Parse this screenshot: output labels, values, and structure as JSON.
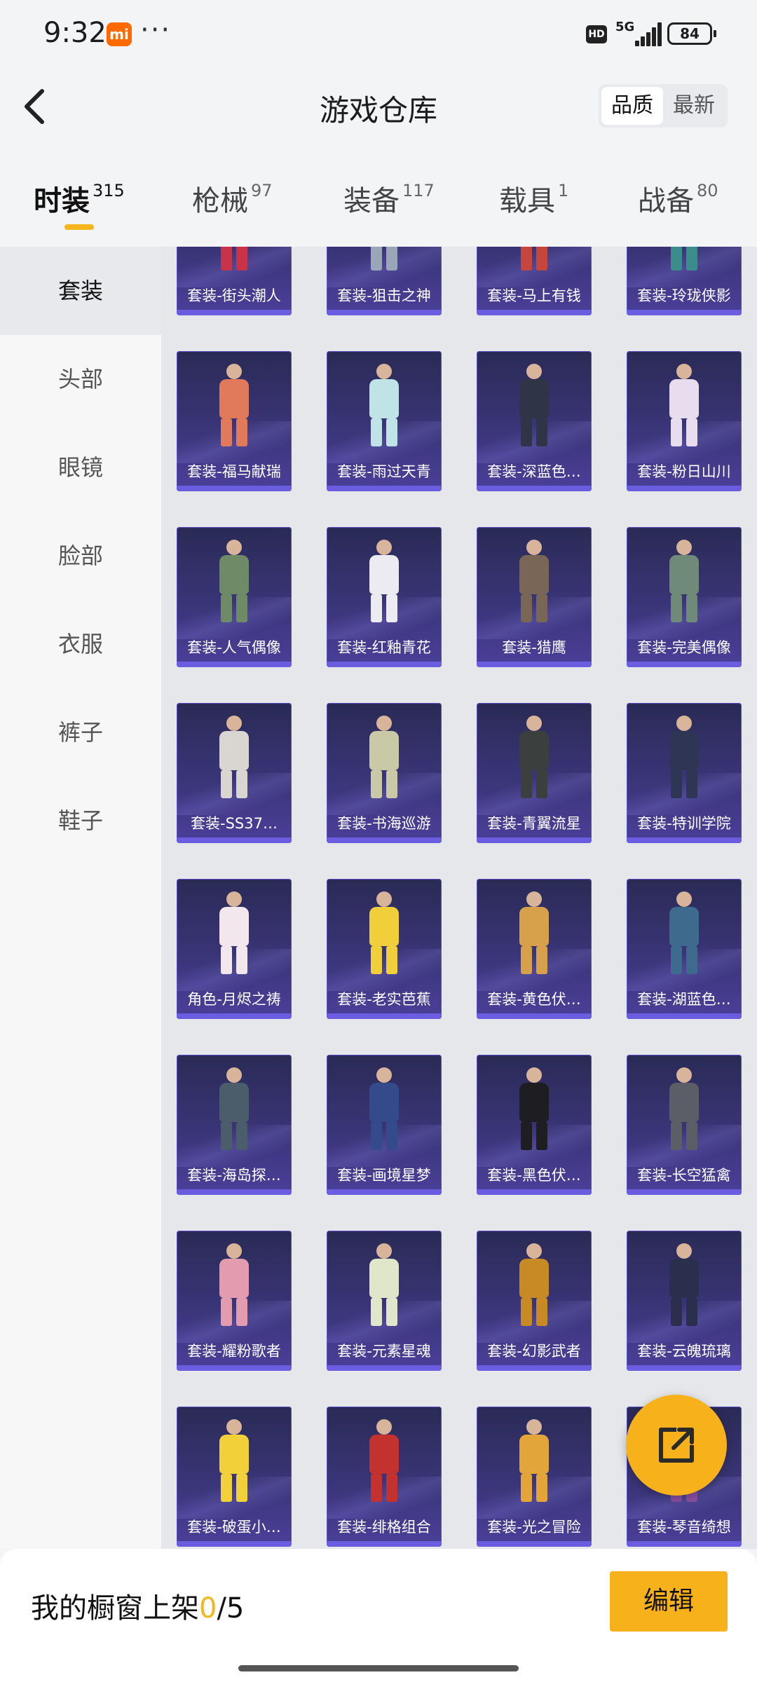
{
  "status_bar": {
    "time": "9:32",
    "carrier_badge": "mi",
    "more": "···",
    "hd": "HD",
    "network": "5G",
    "battery": "84"
  },
  "header": {
    "title": "游戏仓库",
    "sort_options": [
      "品质",
      "最新"
    ],
    "active_sort": "品质"
  },
  "tabs": [
    {
      "label": "时装",
      "count": "315"
    },
    {
      "label": "枪械",
      "count": "97"
    },
    {
      "label": "装备",
      "count": "117"
    },
    {
      "label": "载具",
      "count": "1"
    },
    {
      "label": "战备",
      "count": "80"
    }
  ],
  "sidebar": [
    "套装",
    "头部",
    "眼镜",
    "脸部",
    "衣服",
    "裤子",
    "鞋子"
  ],
  "items": [
    {
      "name": "套装-街头潮人",
      "accent": "#c8334a"
    },
    {
      "name": "套装-狙击之神",
      "accent": "#9aa6b8"
    },
    {
      "name": "套装-马上有钱",
      "accent": "#c6463b"
    },
    {
      "name": "套装-玲珑侠影",
      "accent": "#3a8d8a"
    },
    {
      "name": "套装-福马献瑞",
      "accent": "#e07a5a"
    },
    {
      "name": "套装-雨过天青",
      "accent": "#bfe3e6"
    },
    {
      "name": "套装-深蓝色…",
      "accent": "#2f3446"
    },
    {
      "name": "套装-粉日山川",
      "accent": "#e8dcef"
    },
    {
      "name": "套装-人气偶像",
      "accent": "#6f8a67"
    },
    {
      "name": "套装-红釉青花",
      "accent": "#ecebf2"
    },
    {
      "name": "套装-猎鹰",
      "accent": "#7a6656"
    },
    {
      "name": "套装-完美偶像",
      "accent": "#6f8a78"
    },
    {
      "name": "套装-SS37…",
      "accent": "#d9d5d0"
    },
    {
      "name": "套装-书海巡游",
      "accent": "#c9c9a8"
    },
    {
      "name": "套装-青翼流星",
      "accent": "#3b3f3d"
    },
    {
      "name": "套装-特训学院",
      "accent": "#2e3555"
    },
    {
      "name": "角色-月烬之祷",
      "accent": "#f1e7ec"
    },
    {
      "name": "套装-老实芭蕉",
      "accent": "#f1cf3b"
    },
    {
      "name": "套装-黄色伏…",
      "accent": "#d7a04a"
    },
    {
      "name": "套装-湖蓝色…",
      "accent": "#3d6a8d"
    },
    {
      "name": "套装-海岛探…",
      "accent": "#4b5c6a"
    },
    {
      "name": "套装-画境星梦",
      "accent": "#344a8a"
    },
    {
      "name": "套装-黑色伏…",
      "accent": "#1d1d22"
    },
    {
      "name": "套装-长空猛禽",
      "accent": "#5b5e66"
    },
    {
      "name": "套装-耀粉歌者",
      "accent": "#e39bb0"
    },
    {
      "name": "套装-元素星魂",
      "accent": "#dfe6c9"
    },
    {
      "name": "套装-幻影武者",
      "accent": "#c78a24"
    },
    {
      "name": "套装-云魄琉璃",
      "accent": "#2a2f4d"
    },
    {
      "name": "套装-破蛋小…",
      "accent": "#f1d03a"
    },
    {
      "name": "套装-绯格组合",
      "accent": "#c4322f"
    },
    {
      "name": "套装-光之冒险",
      "accent": "#e3a43a"
    },
    {
      "name": "套装-琴音绮想",
      "accent": "#8a4fa3"
    }
  ],
  "bottom": {
    "label": "我的橱窗上架",
    "used": "0",
    "total": "/5",
    "edit_label": "编辑"
  }
}
